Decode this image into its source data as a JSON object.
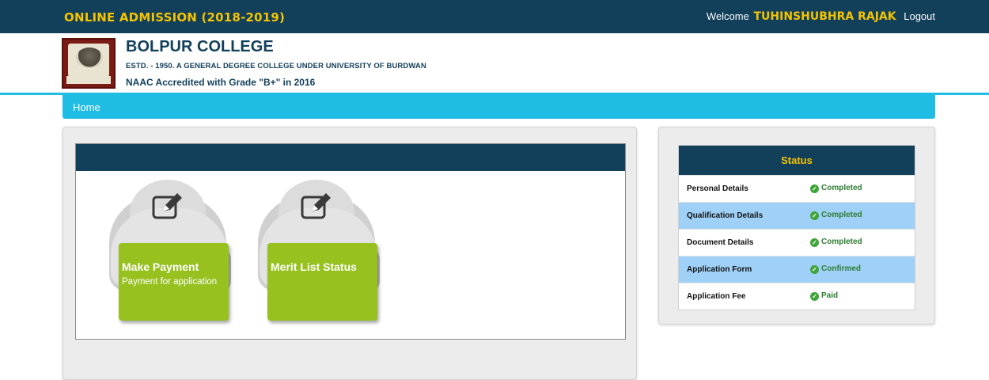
{
  "topbar": {
    "title": "ONLINE ADMISSION (2018-2019)",
    "welcome_label": "Welcome",
    "user_name": "TUHINSHUBHRA RAJAK",
    "logout_label": "Logout"
  },
  "header": {
    "college_name": "BOLPUR COLLEGE",
    "estd_line": "ESTD. - 1950. A GENERAL DEGREE COLLEGE UNDER UNIVERSITY OF BURDWAN",
    "naac_line": "NAAC Accredited with Grade \"B+\" in 2016",
    "logo_icon": "college-emblem"
  },
  "nav": {
    "home_label": "Home"
  },
  "tiles": [
    {
      "title": "Make Payment",
      "subtitle": "Payment for application",
      "icon": "edit-icon"
    },
    {
      "title": "Merit List Status",
      "subtitle": "",
      "icon": "edit-icon"
    }
  ],
  "status": {
    "heading": "Status",
    "rows": [
      {
        "label": "Personal Details",
        "value": "Completed"
      },
      {
        "label": "Qualification Details",
        "value": "Completed"
      },
      {
        "label": "Document Details",
        "value": "Completed"
      },
      {
        "label": "Application Form",
        "value": "Confirmed"
      },
      {
        "label": "Application Fee",
        "value": "Paid"
      }
    ]
  },
  "colors": {
    "topbar_bg": "#123f5a",
    "accent_yellow": "#f5c400",
    "nav_bg": "#1fbce3",
    "tile_green": "#96c11f",
    "row_alt": "#9fd0f7",
    "status_green": "#2e7d32"
  }
}
